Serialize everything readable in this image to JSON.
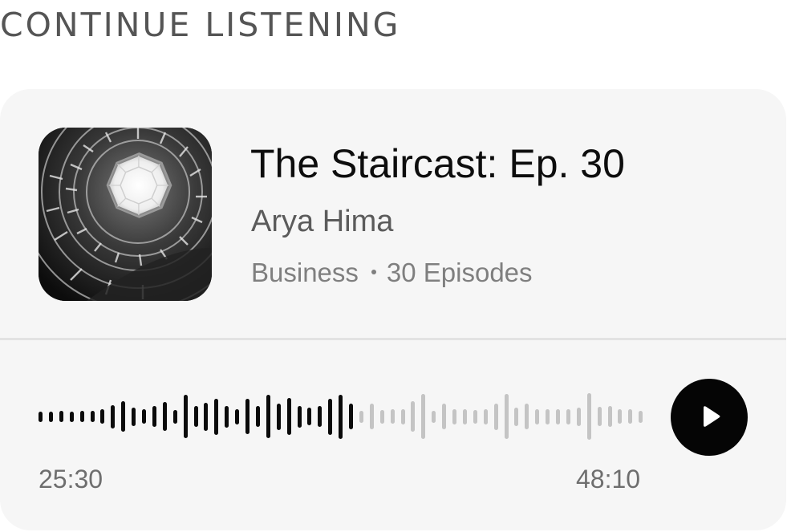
{
  "section": {
    "heading": "CONTINUE LISTENING"
  },
  "episode": {
    "title": "The Staircast: Ep. 30",
    "author": "Arya Hima",
    "category": "Business",
    "episodes": "30 Episodes",
    "artwork_icon": "spiral-staircase-artwork"
  },
  "player": {
    "current_time": "25:30",
    "total_time": "48:10",
    "progress": 0.53,
    "play_icon": "play-icon",
    "colors": {
      "played": "#0a0a0a",
      "unplayed": "#c4c4c4",
      "button": "#050505"
    },
    "waveform": [
      0.2,
      0.2,
      0.22,
      0.2,
      0.22,
      0.22,
      0.28,
      0.45,
      0.6,
      0.36,
      0.28,
      0.4,
      0.56,
      0.26,
      0.85,
      0.4,
      0.55,
      0.7,
      0.42,
      0.3,
      0.68,
      0.4,
      0.85,
      0.52,
      0.72,
      0.42,
      0.34,
      0.4,
      0.7,
      0.86,
      0.5,
      0.24,
      0.5,
      0.26,
      0.28,
      0.3,
      0.6,
      0.88,
      0.24,
      0.5,
      0.3,
      0.3,
      0.26,
      0.3,
      0.52,
      0.88,
      0.36,
      0.5,
      0.3,
      0.3,
      0.3,
      0.3,
      0.36,
      0.9,
      0.38,
      0.4,
      0.28,
      0.28,
      0.24
    ]
  }
}
